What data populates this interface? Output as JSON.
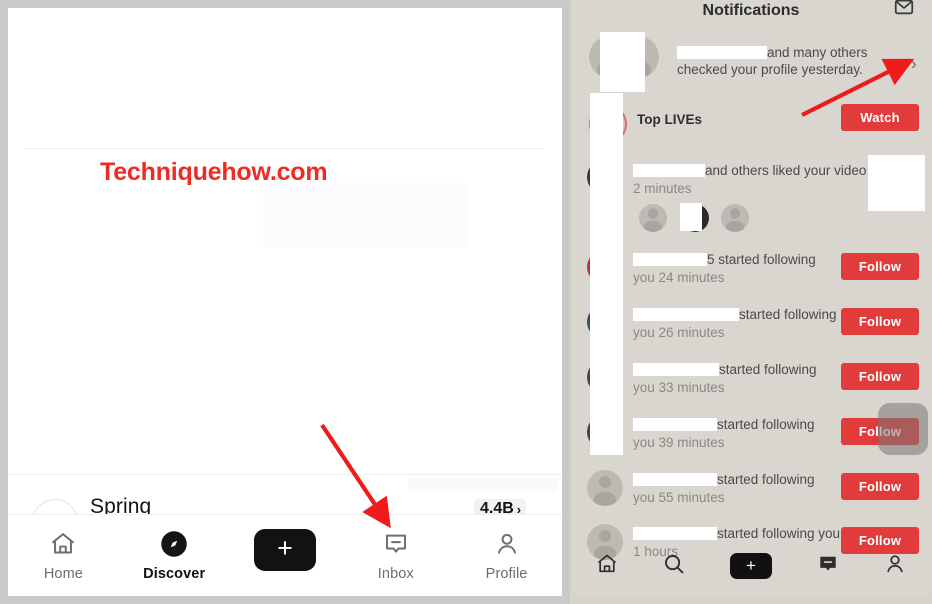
{
  "watermark": {
    "text": "Techniquehow.com",
    "color": "#ee2b24"
  },
  "left_screen": {
    "spring_row": {
      "label": "Spring",
      "avatar_dots": "··",
      "count": "4.4B",
      "chevron": "›"
    },
    "bottom_nav": {
      "items": [
        {
          "label": "Home",
          "icon": "home-icon",
          "active": false
        },
        {
          "label": "Discover",
          "icon": "compass-icon",
          "active": true
        },
        {
          "label": "",
          "icon": "plus-icon",
          "active": false
        },
        {
          "label": "Inbox",
          "icon": "inbox-icon",
          "active": false
        },
        {
          "label": "Profile",
          "icon": "person-icon",
          "active": false
        }
      ],
      "plus_glyph": "+"
    }
  },
  "right_screen": {
    "header": {
      "title": "Notifications",
      "mail_icon": "envelope-icon"
    },
    "profile_views": {
      "text_line1_suffix": "and many others",
      "text_line2": "checked your profile yesterday.",
      "chevron": "›"
    },
    "top_lives": {
      "label": "Top LIVEs",
      "button": "Watch"
    },
    "liked_video": {
      "text_suffix": "and others liked your video",
      "time": "2 minutes"
    },
    "follow_rows": [
      {
        "text_suffix": "5 started following",
        "time_line": "you 24 minutes",
        "button": "Follow"
      },
      {
        "text_suffix": "started following",
        "time_line": "you 26 minutes",
        "button": "Follow"
      },
      {
        "text_suffix": "started following",
        "time_line": "you 33 minutes",
        "button": "Follow"
      },
      {
        "text_suffix": "started following",
        "time_line": "you 39 minutes",
        "button": "Follow"
      },
      {
        "text_suffix": "started following",
        "time_line": "you 55 minutes",
        "button": "Follow"
      },
      {
        "text_suffix": "started following you",
        "time_line": "1 hours",
        "button": "Follow"
      }
    ],
    "bottom_nav": {
      "items": [
        "home-icon",
        "search-icon",
        "plus-icon",
        "inbox-icon",
        "person-icon"
      ],
      "plus_glyph": "+"
    }
  },
  "annotations": {
    "arrow_color": "#f01b1b",
    "arrow_left_target": "inbox-nav-item",
    "arrow_right_target": "profile-views-chevron"
  },
  "colors": {
    "accent_red": "#e23b3b",
    "watermark_red": "#ee2b24",
    "panel_background": "#d9d6d0",
    "nav_inactive": "#6d6d72"
  }
}
